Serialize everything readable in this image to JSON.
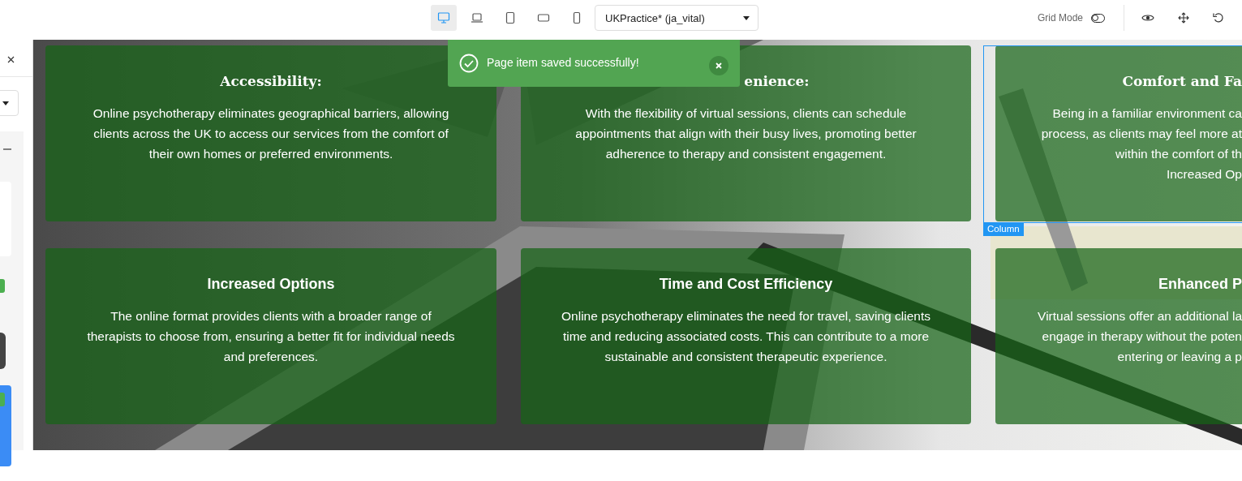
{
  "toolbar": {
    "devices": [
      {
        "kind": "desktop",
        "selected": true
      },
      {
        "kind": "laptop",
        "selected": false
      },
      {
        "kind": "tablet",
        "selected": false
      },
      {
        "kind": "tablet-landscape",
        "selected": false
      },
      {
        "kind": "phone",
        "selected": false
      }
    ],
    "template_select": {
      "value": "UKPractice* (ja_vital)"
    },
    "grid_mode": {
      "label": "Grid Mode",
      "on": false
    }
  },
  "toast": {
    "message": "Page item saved successfully!"
  },
  "selection": {
    "label": "Column"
  },
  "rows": [
    {
      "kind": "classic",
      "cards": [
        {
          "title": "Accessibility:",
          "lines": [
            "Online psychotherapy eliminates geographical barriers, allowing",
            "clients across the UK to access our services from the comfort of",
            "their own homes or preferred environments."
          ]
        },
        {
          "title": "enience:",
          "lines": [
            "With the flexibility of virtual sessions, clients can schedule",
            "appointments that align with their busy lives, promoting better",
            "adherence to therapy and consistent engagement."
          ]
        },
        {
          "title": "Comfort and Fa",
          "lines": [
            "Being in a familiar environment ca",
            "process, as clients may feel more at",
            "within the comfort of th",
            "Increased Op"
          ]
        }
      ]
    },
    {
      "kind": "modern",
      "cards": [
        {
          "title": "Increased Options",
          "lines": [
            "The online format provides clients with a broader range of",
            "therapists to choose from, ensuring a better fit for individual needs",
            "and preferences."
          ]
        },
        {
          "title": "Time and Cost Efficiency",
          "lines": [
            "Online psychotherapy eliminates the need for travel, saving clients",
            "time and reducing associated costs. This can contribute to a more",
            "sustainable and consistent therapeutic experience."
          ]
        },
        {
          "title": "Enhanced P",
          "lines": [
            "Virtual sessions offer an additional la",
            "engage in therapy without the poten",
            "entering or leaving a p"
          ]
        }
      ]
    }
  ]
}
